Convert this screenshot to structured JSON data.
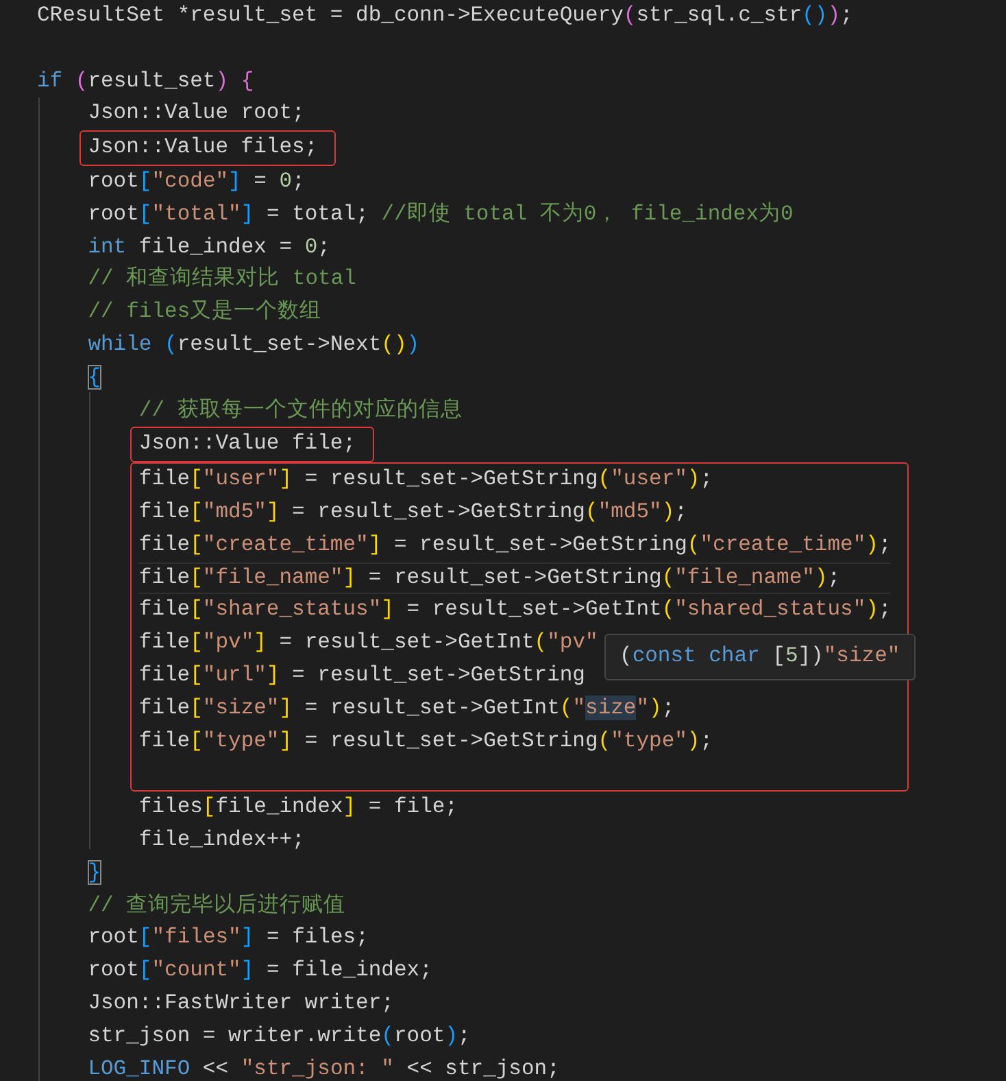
{
  "editor": {
    "blocks": [
      {
        "boxed": false,
        "lines": [
          {
            "current": false,
            "tokens": [
              {
                "kind": "plain",
                "text": "CResultSet *result_set = db_conn->ExecuteQuery"
              },
              {
                "kind": "bracket2",
                "text": "("
              },
              {
                "kind": "plain",
                "text": "str_sql.c_str"
              },
              {
                "kind": "bracket3",
                "text": "()"
              },
              {
                "kind": "bracket2",
                "text": ")"
              },
              {
                "kind": "plain",
                "text": ";"
              }
            ]
          },
          {
            "current": false
          },
          {
            "current": false,
            "tokens": [
              {
                "kind": "keyword",
                "text": "if "
              },
              {
                "kind": "bracket2",
                "text": "("
              },
              {
                "kind": "plain",
                "text": "result_set"
              },
              {
                "kind": "bracket2",
                "text": ")"
              },
              {
                "kind": "bracket2",
                "text": " {"
              }
            ]
          },
          {
            "current": false,
            "tokens": [
              {
                "kind": "plain",
                "text": "    Json::Value root;"
              }
            ]
          }
        ]
      },
      {
        "boxed": true,
        "lines": [
          {
            "current": false,
            "tokens": [
              {
                "kind": "plain",
                "text": "    Json::Value files;"
              }
            ]
          }
        ]
      },
      {
        "boxed": false,
        "lines": [
          {
            "current": false,
            "tokens": [
              {
                "kind": "plain",
                "text": "    root"
              },
              {
                "kind": "bracket3",
                "text": "["
              },
              {
                "kind": "string",
                "text": "\"code\""
              },
              {
                "kind": "bracket3",
                "text": "]"
              },
              {
                "kind": "plain",
                "text": " = "
              },
              {
                "kind": "number",
                "text": "0"
              },
              {
                "kind": "plain",
                "text": ";"
              }
            ]
          },
          {
            "current": false,
            "tokens": [
              {
                "kind": "plain",
                "text": "    root"
              },
              {
                "kind": "bracket3",
                "text": "["
              },
              {
                "kind": "string",
                "text": "\"total\""
              },
              {
                "kind": "bracket3",
                "text": "]"
              },
              {
                "kind": "plain",
                "text": " = total; "
              },
              {
                "kind": "comment",
                "text": "//即使 total 不为0， file_index为0"
              }
            ]
          },
          {
            "current": false,
            "tokens": [
              {
                "kind": "keyword",
                "text": "    int"
              },
              {
                "kind": "plain",
                "text": " file_index = "
              },
              {
                "kind": "number",
                "text": "0"
              },
              {
                "kind": "plain",
                "text": ";"
              }
            ]
          },
          {
            "current": false,
            "tokens": [
              {
                "kind": "comment",
                "text": "    // 和查询结果对比 total"
              }
            ]
          },
          {
            "current": false,
            "tokens": [
              {
                "kind": "comment",
                "text": "    // files又是一个数组"
              }
            ]
          },
          {
            "current": false,
            "tokens": [
              {
                "kind": "keyword",
                "text": "    while "
              },
              {
                "kind": "bracket3",
                "text": "("
              },
              {
                "kind": "plain",
                "text": "result_set->Next"
              },
              {
                "kind": "bracket1",
                "text": "()"
              },
              {
                "kind": "bracket3",
                "text": ")"
              }
            ]
          },
          {
            "current": false,
            "tokens": [
              {
                "kind": "match",
                "text": "    {"
              }
            ]
          },
          {
            "current": false,
            "tokens": [
              {
                "kind": "comment",
                "text": "        // 获取每一个文件的对应的信息"
              }
            ]
          }
        ]
      },
      {
        "boxed": true,
        "lines": [
          {
            "current": false,
            "tokens": [
              {
                "kind": "plain",
                "text": "        Json::Value file;"
              }
            ]
          }
        ]
      },
      {
        "boxed": true,
        "lines": [
          {
            "current": false,
            "tokens": [
              {
                "kind": "plain",
                "text": "        file"
              },
              {
                "kind": "bracket1",
                "text": "["
              },
              {
                "kind": "string",
                "text": "\"user\""
              },
              {
                "kind": "bracket1",
                "text": "]"
              },
              {
                "kind": "plain",
                "text": " = result_set->GetString"
              },
              {
                "kind": "bracket1",
                "text": "("
              },
              {
                "kind": "string",
                "text": "\"user\""
              },
              {
                "kind": "bracket1",
                "text": ")"
              },
              {
                "kind": "plain",
                "text": ";"
              }
            ]
          },
          {
            "current": false,
            "tokens": [
              {
                "kind": "plain",
                "text": "        file"
              },
              {
                "kind": "bracket1",
                "text": "["
              },
              {
                "kind": "string",
                "text": "\"md5\""
              },
              {
                "kind": "bracket1",
                "text": "]"
              },
              {
                "kind": "plain",
                "text": " = result_set->GetString"
              },
              {
                "kind": "bracket1",
                "text": "("
              },
              {
                "kind": "string",
                "text": "\"md5\""
              },
              {
                "kind": "bracket1",
                "text": ")"
              },
              {
                "kind": "plain",
                "text": ";"
              }
            ]
          },
          {
            "current": false,
            "tokens": [
              {
                "kind": "plain",
                "text": "        file"
              },
              {
                "kind": "bracket1",
                "text": "["
              },
              {
                "kind": "string",
                "text": "\"create_time\""
              },
              {
                "kind": "bracket1",
                "text": "]"
              },
              {
                "kind": "plain",
                "text": " = result_set->GetString"
              },
              {
                "kind": "bracket1",
                "text": "("
              },
              {
                "kind": "string",
                "text": "\"create_time\""
              },
              {
                "kind": "bracket1",
                "text": ")"
              },
              {
                "kind": "plain",
                "text": ";"
              }
            ]
          },
          {
            "current": true,
            "tokens": [
              {
                "kind": "plain",
                "text": "        file"
              },
              {
                "kind": "bracket1",
                "text": "["
              },
              {
                "kind": "string",
                "text": "\"file_name\""
              },
              {
                "kind": "bracket1",
                "text": "]"
              },
              {
                "kind": "plain",
                "text": " = result_set->GetString"
              },
              {
                "kind": "bracket1",
                "text": "("
              },
              {
                "kind": "string",
                "text": "\"file_name\""
              },
              {
                "kind": "bracket1",
                "text": ")"
              },
              {
                "kind": "plain",
                "text": ";"
              }
            ]
          },
          {
            "current": false,
            "tokens": [
              {
                "kind": "plain",
                "text": "        file"
              },
              {
                "kind": "bracket1",
                "text": "["
              },
              {
                "kind": "string",
                "text": "\"share_status\""
              },
              {
                "kind": "bracket1",
                "text": "]"
              },
              {
                "kind": "plain",
                "text": " = result_set->GetInt"
              },
              {
                "kind": "bracket1",
                "text": "("
              },
              {
                "kind": "string",
                "text": "\"shared_status\""
              },
              {
                "kind": "bracket1",
                "text": ")"
              },
              {
                "kind": "plain",
                "text": ";"
              }
            ]
          },
          {
            "current": false,
            "tokens": [
              {
                "kind": "plain",
                "text": "        file"
              },
              {
                "kind": "bracket1",
                "text": "["
              },
              {
                "kind": "string",
                "text": "\"pv\""
              },
              {
                "kind": "bracket1",
                "text": "]"
              },
              {
                "kind": "plain",
                "text": " = result_set->GetInt"
              },
              {
                "kind": "bracket1",
                "text": "("
              },
              {
                "kind": "string",
                "text": "\"pv\""
              }
            ]
          },
          {
            "current": false,
            "tokens": [
              {
                "kind": "plain",
                "text": "        file"
              },
              {
                "kind": "bracket1",
                "text": "["
              },
              {
                "kind": "string",
                "text": "\"url\""
              },
              {
                "kind": "bracket1",
                "text": "]"
              },
              {
                "kind": "plain",
                "text": " = result_set->GetString"
              }
            ]
          },
          {
            "current": false,
            "tokens": [
              {
                "kind": "plain",
                "text": "        file"
              },
              {
                "kind": "bracket1",
                "text": "["
              },
              {
                "kind": "string",
                "text": "\"size\""
              },
              {
                "kind": "bracket1",
                "text": "]"
              },
              {
                "kind": "plain",
                "text": " = result_set->GetInt"
              },
              {
                "kind": "bracket1",
                "text": "("
              },
              {
                "kind": "string",
                "text": "\""
              },
              {
                "kind": "hover",
                "text": "size"
              },
              {
                "kind": "string",
                "text": "\""
              },
              {
                "kind": "bracket1",
                "text": ")"
              },
              {
                "kind": "plain",
                "text": ";"
              }
            ]
          },
          {
            "current": false,
            "tokens": [
              {
                "kind": "plain",
                "text": "        file"
              },
              {
                "kind": "bracket1",
                "text": "["
              },
              {
                "kind": "string",
                "text": "\"type\""
              },
              {
                "kind": "bracket1",
                "text": "]"
              },
              {
                "kind": "plain",
                "text": " = result_set->GetString"
              },
              {
                "kind": "bracket1",
                "text": "("
              },
              {
                "kind": "string",
                "text": "\"type\""
              },
              {
                "kind": "bracket1",
                "text": ")"
              },
              {
                "kind": "plain",
                "text": ";"
              }
            ]
          },
          {
            "current": false
          }
        ]
      },
      {
        "boxed": false,
        "lines": [
          {
            "current": false,
            "tokens": [
              {
                "kind": "plain",
                "text": "        files"
              },
              {
                "kind": "bracket1",
                "text": "["
              },
              {
                "kind": "plain",
                "text": "file_index"
              },
              {
                "kind": "bracket1",
                "text": "]"
              },
              {
                "kind": "plain",
                "text": " = file;"
              }
            ]
          },
          {
            "current": false,
            "tokens": [
              {
                "kind": "plain",
                "text": "        file_index++;"
              }
            ]
          },
          {
            "current": false,
            "tokens": [
              {
                "kind": "match",
                "text": "    }"
              }
            ]
          },
          {
            "current": false,
            "tokens": [
              {
                "kind": "comment",
                "text": "    // 查询完毕以后进行赋值"
              }
            ]
          },
          {
            "current": false,
            "tokens": [
              {
                "kind": "plain",
                "text": "    root"
              },
              {
                "kind": "bracket3",
                "text": "["
              },
              {
                "kind": "string",
                "text": "\"files\""
              },
              {
                "kind": "bracket3",
                "text": "]"
              },
              {
                "kind": "plain",
                "text": " = files;"
              }
            ]
          },
          {
            "current": false,
            "tokens": [
              {
                "kind": "plain",
                "text": "    root"
              },
              {
                "kind": "bracket3",
                "text": "["
              },
              {
                "kind": "string",
                "text": "\"count\""
              },
              {
                "kind": "bracket3",
                "text": "]"
              },
              {
                "kind": "plain",
                "text": " = file_index;"
              }
            ]
          },
          {
            "current": false,
            "tokens": [
              {
                "kind": "plain",
                "text": "    Json::FastWriter writer;"
              }
            ]
          },
          {
            "current": false,
            "tokens": [
              {
                "kind": "plain",
                "text": "    str_json = writer.write"
              },
              {
                "kind": "bracket3",
                "text": "("
              },
              {
                "kind": "plain",
                "text": "root"
              },
              {
                "kind": "bracket3",
                "text": ")"
              },
              {
                "kind": "plain",
                "text": ";"
              }
            ]
          },
          {
            "current": false,
            "tokens": [
              {
                "kind": "keyword",
                "text": "    LOG_INFO"
              },
              {
                "kind": "plain",
                "text": " << "
              },
              {
                "kind": "string",
                "text": "\"str_json: \""
              },
              {
                "kind": "plain",
                "text": " << str_json;"
              }
            ]
          }
        ]
      }
    ]
  },
  "tooltip": {
    "tokens": [
      {
        "kind": "plain",
        "text": "("
      },
      {
        "kind": "keyword",
        "text": "const char"
      },
      {
        "kind": "plain",
        "text": " ["
      },
      {
        "kind": "number",
        "text": "5"
      },
      {
        "kind": "plain",
        "text": "])"
      },
      {
        "kind": "string",
        "text": "\"size\""
      }
    ]
  }
}
